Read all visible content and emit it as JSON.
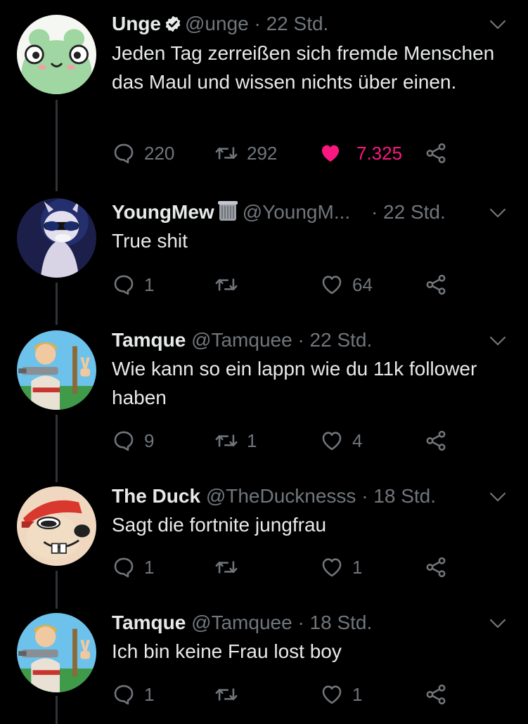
{
  "tweets": [
    {
      "name": "Unge",
      "verified": true,
      "handle": "@unge",
      "time": "· 22 Std.",
      "text": "Jeden Tag zerreißen sich fremde Menschen das Maul und wissen nichts über einen.",
      "replies": "220",
      "retweets": "292",
      "likes": "7.325",
      "liked": true
    },
    {
      "name": "YoungMew",
      "handle": "@YoungM...",
      "time": "· 22 Std.",
      "text": "True shit",
      "replies": "1",
      "retweets": "",
      "likes": "64"
    },
    {
      "name": "Tamque",
      "handle": "@Tamquee",
      "time": "· 22 Std.",
      "text": "Wie kann so ein lappn wie du 11k follower haben",
      "replies": "9",
      "retweets": "1",
      "likes": "4"
    },
    {
      "name": "The Duck",
      "handle": "@TheDucknesss",
      "time": "· 18 Std.",
      "text": "Sagt die fortnite jungfrau",
      "replies": "1",
      "retweets": "",
      "likes": "1"
    },
    {
      "name": "Tamque",
      "handle": "@Tamquee",
      "time": "· 18 Std.",
      "text": "Ich bin keine Frau lost boy",
      "replies": "1",
      "retweets": "",
      "likes": "1"
    }
  ],
  "colors": {
    "background": "#000000",
    "text": "#e7e9ea",
    "muted": "#71767b",
    "like": "#f91880"
  },
  "icons": [
    "reply-icon",
    "retweet-icon",
    "like-icon",
    "share-icon",
    "chevron-down-icon",
    "verified-icon",
    "trash-emoji-icon"
  ]
}
